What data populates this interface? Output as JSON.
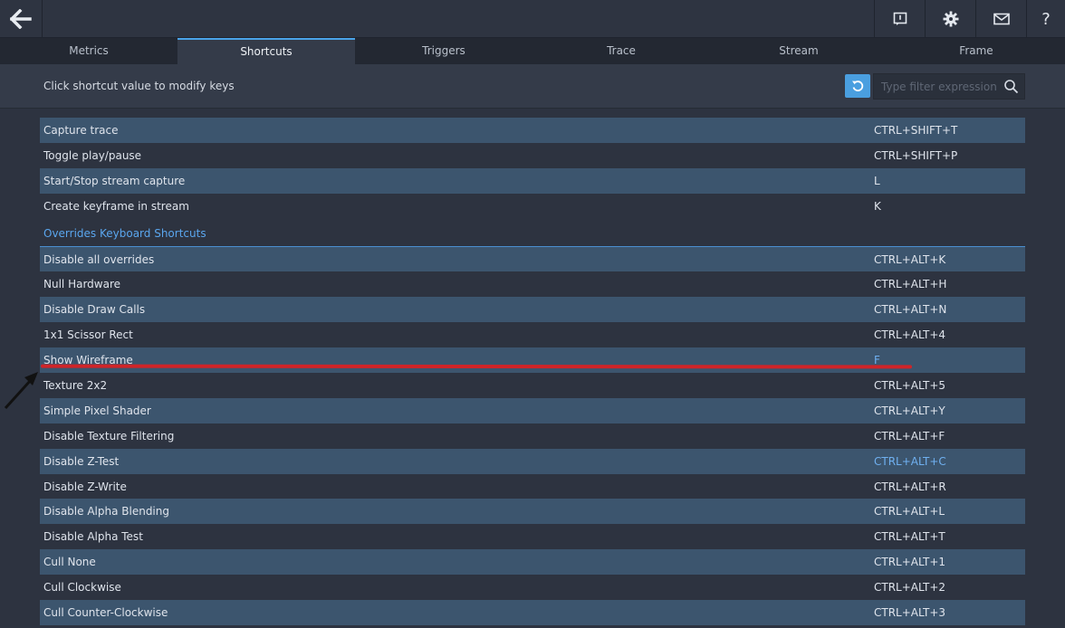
{
  "topbar": {
    "back_icon": "arrow-left-icon",
    "icons": [
      "report-icon",
      "gear-icon",
      "mail-icon"
    ],
    "help_label": "?"
  },
  "tabs": [
    {
      "label": "Metrics",
      "active": false
    },
    {
      "label": "Shortcuts",
      "active": true
    },
    {
      "label": "Triggers",
      "active": false
    },
    {
      "label": "Trace",
      "active": false
    },
    {
      "label": "Stream",
      "active": false
    },
    {
      "label": "Frame",
      "active": false
    }
  ],
  "toolbar": {
    "hint": "Click shortcut value to modify keys",
    "filter_placeholder": "Type filter expression",
    "reset_icon": "reset-icon",
    "search_icon": "search-icon"
  },
  "shortcuts_top": [
    {
      "label": "Capture trace",
      "value": "CTRL+SHIFT+T"
    },
    {
      "label": "Toggle play/pause",
      "value": "CTRL+SHIFT+P"
    },
    {
      "label": "Start/Stop stream capture",
      "value": "L"
    },
    {
      "label": "Create keyframe in stream",
      "value": "K"
    }
  ],
  "section_title": "Overrides Keyboard Shortcuts",
  "shortcuts_overrides": [
    {
      "label": "Disable all overrides",
      "value": "CTRL+ALT+K"
    },
    {
      "label": "Null Hardware",
      "value": "CTRL+ALT+H"
    },
    {
      "label": "Disable Draw Calls",
      "value": "CTRL+ALT+N"
    },
    {
      "label": "1x1 Scissor Rect",
      "value": "CTRL+ALT+4"
    },
    {
      "label": "Show Wireframe",
      "value": "F"
    },
    {
      "label": "Texture 2x2",
      "value": "CTRL+ALT+5"
    },
    {
      "label": "Simple Pixel Shader",
      "value": "CTRL+ALT+Y"
    },
    {
      "label": "Disable Texture Filtering",
      "value": "CTRL+ALT+F"
    },
    {
      "label": "Disable Z-Test",
      "value": "CTRL+ALT+C"
    },
    {
      "label": "Disable Z-Write",
      "value": "CTRL+ALT+R"
    },
    {
      "label": "Disable Alpha Blending",
      "value": "CTRL+ALT+L"
    },
    {
      "label": "Disable Alpha Test",
      "value": "CTRL+ALT+T"
    },
    {
      "label": "Cull None",
      "value": "CTRL+ALT+1"
    },
    {
      "label": "Cull Clockwise",
      "value": "CTRL+ALT+2"
    },
    {
      "label": "Cull Counter-Clockwise",
      "value": "CTRL+ALT+3"
    }
  ],
  "colors": {
    "accent": "#4aa3e8",
    "row_stripe": "#3c556e",
    "annotation_red": "#d02428"
  }
}
